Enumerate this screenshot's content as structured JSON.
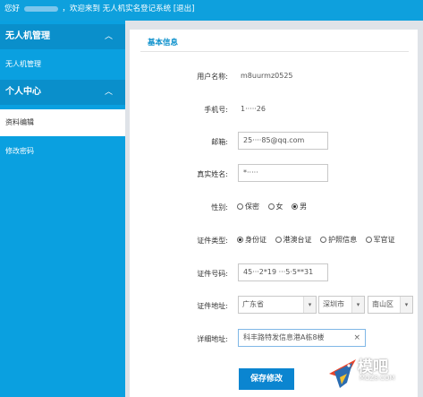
{
  "header": {
    "greeting": "您好",
    "welcome": "，欢迎来到 无人机实名登记系统 [退出]"
  },
  "sidebar": {
    "sections": [
      {
        "title": "无人机管理",
        "items": [
          "无人机管理"
        ]
      },
      {
        "title": "个人中心",
        "items": [
          "资料编辑",
          "修改密码"
        ]
      }
    ]
  },
  "panel": {
    "title": "基本信息",
    "fields": {
      "username": {
        "label": "用户名称:",
        "value": "m8uurmz0525"
      },
      "phone": {
        "label": "手机号:",
        "value": "1·····26"
      },
      "email": {
        "label": "邮箱:",
        "value": "25····85@qq.com"
      },
      "realname": {
        "label": "真实姓名:",
        "value": "*·····"
      },
      "gender": {
        "label": "性别:",
        "options": [
          "保密",
          "女",
          "男"
        ],
        "selected": "男"
      },
      "id_type": {
        "label": "证件类型:",
        "options": [
          "身份证",
          "港澳台证",
          "护照信息",
          "军官证"
        ],
        "selected": "身份证"
      },
      "id_number": {
        "label": "证件号码:",
        "value": "45···2*19 ···5·5**31"
      },
      "id_address": {
        "label": "证件地址:",
        "province": "广东省",
        "city": "深圳市",
        "district": "南山区"
      },
      "detail_address": {
        "label": "详细地址:",
        "value": "科丰路特发信息港A栋8楼"
      }
    },
    "save_label": "保存修改"
  },
  "watermark": {
    "text": "模吧",
    "sub": "MOZ8.COM"
  }
}
